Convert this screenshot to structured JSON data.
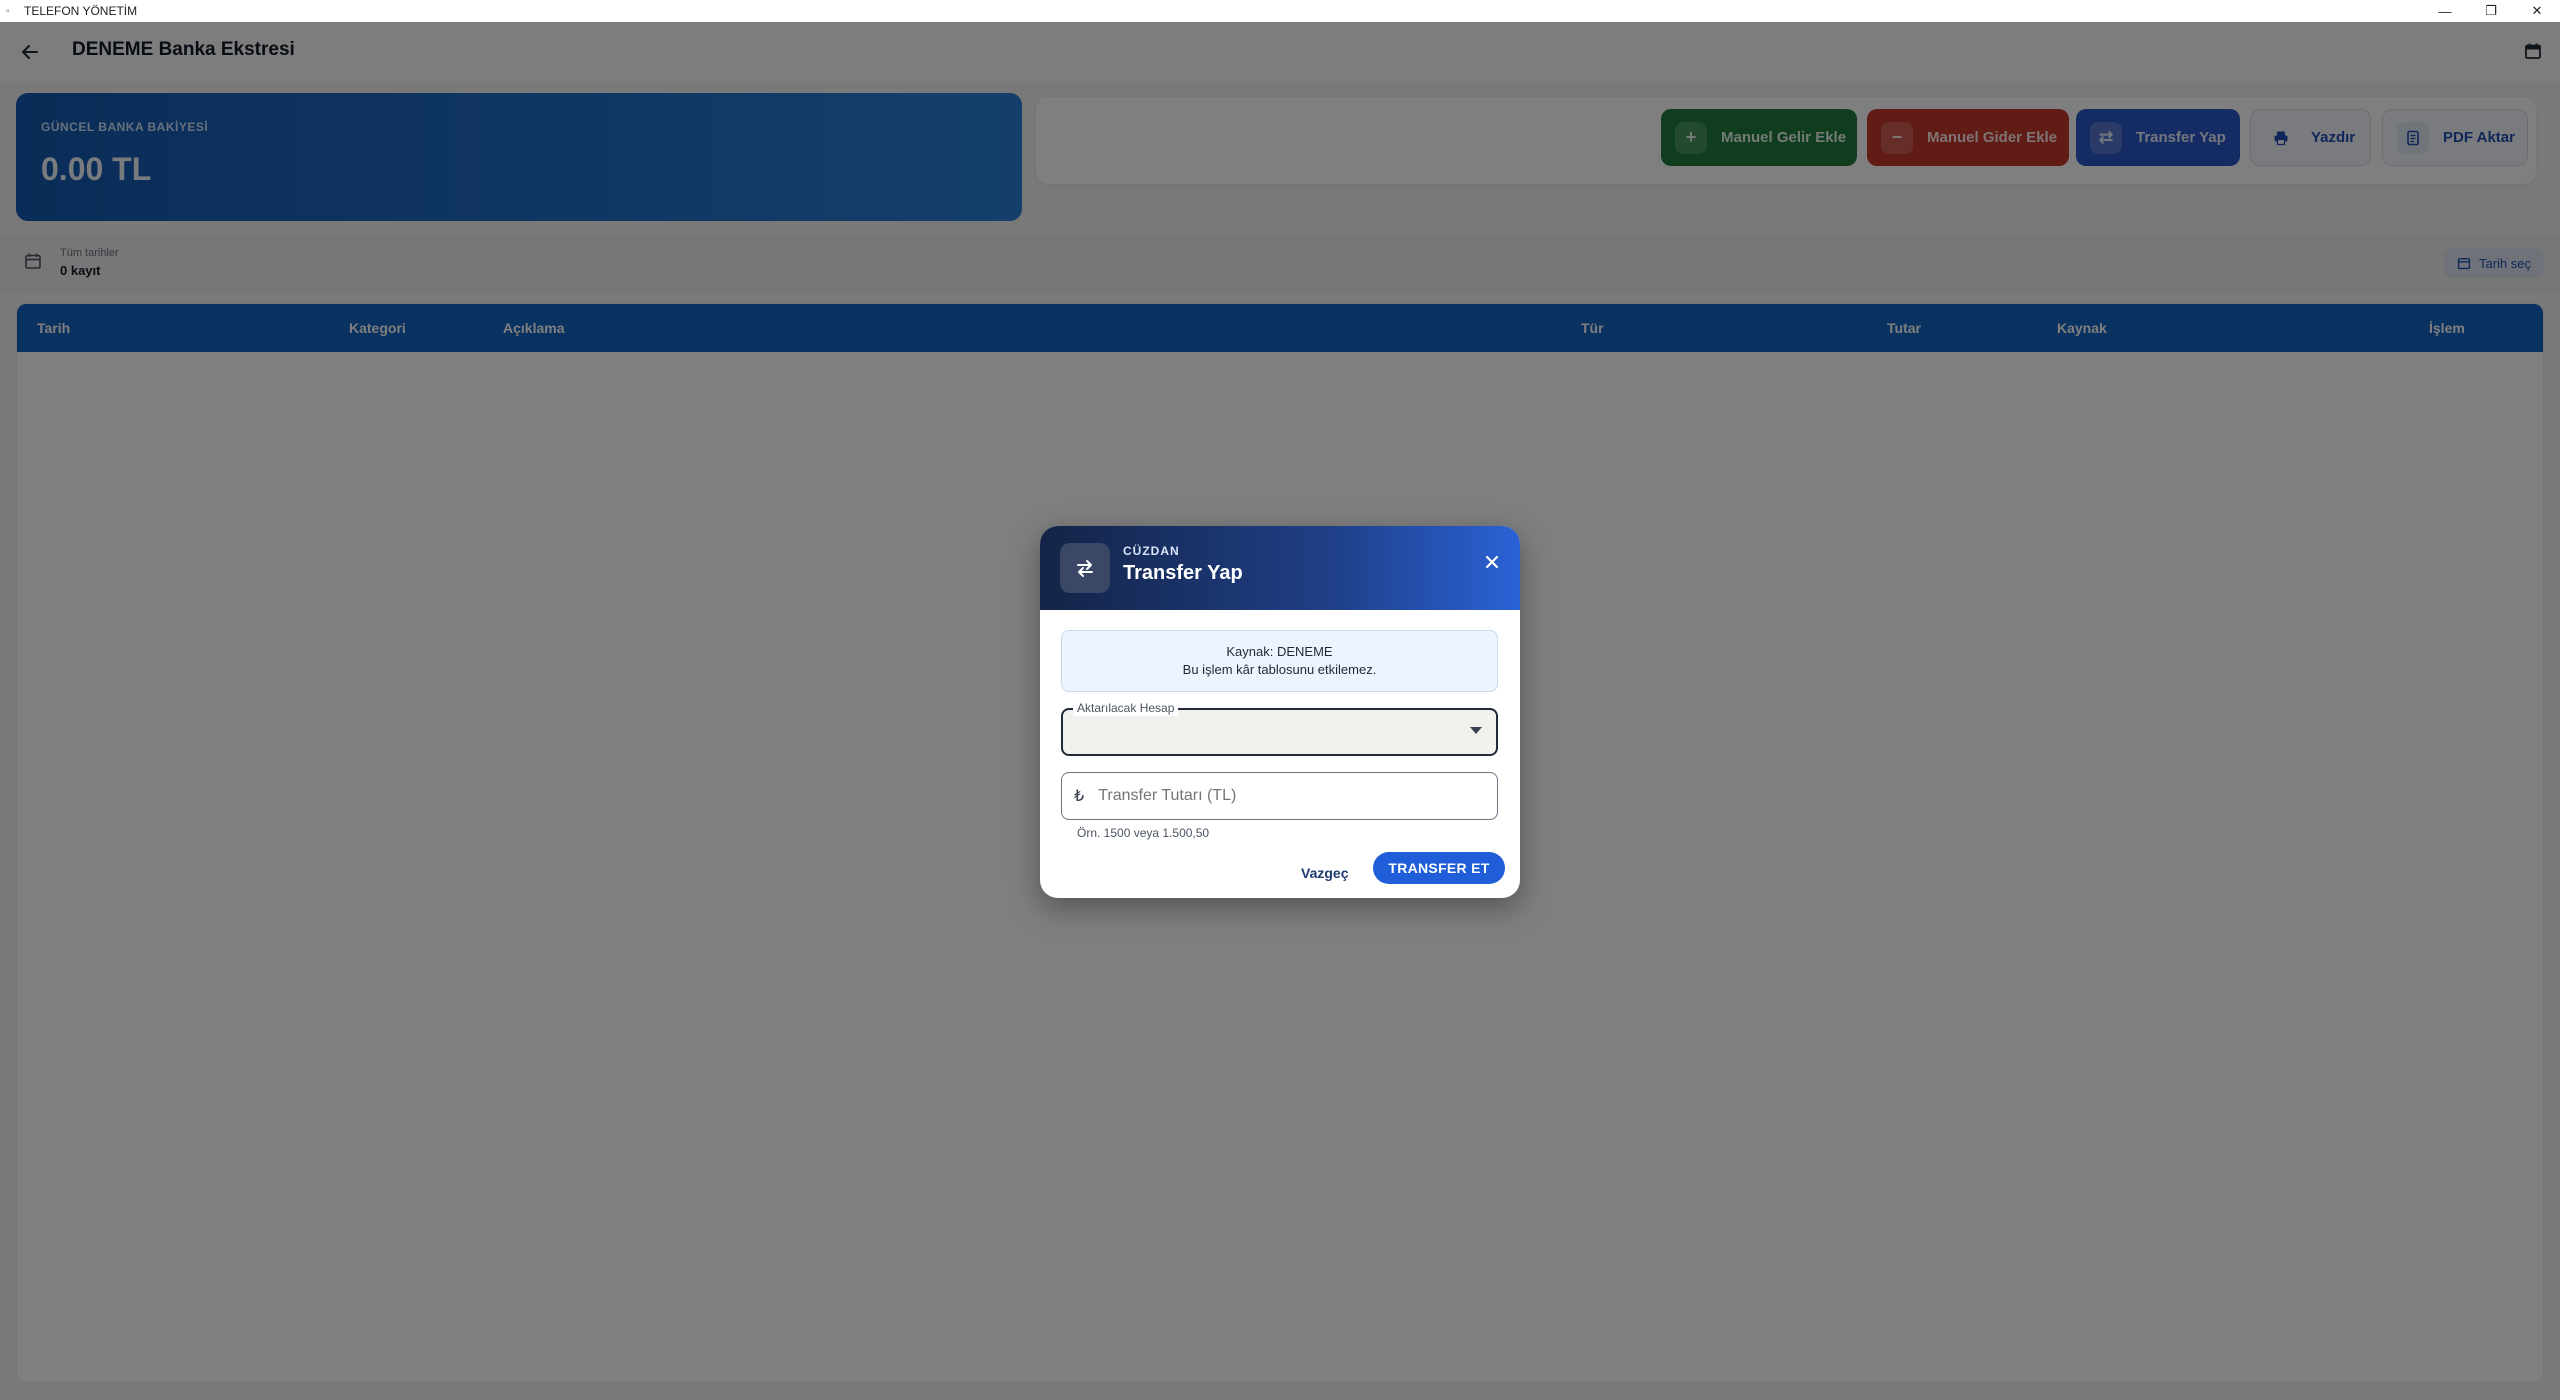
{
  "window": {
    "title": "TELEFON YÖNETİM",
    "controls": {
      "minimize": "—",
      "restore": "❐",
      "close": "✕"
    }
  },
  "appbar": {
    "title": "DENEME Banka Ekstresi",
    "back_icon": "arrow-left-icon",
    "calendar_icon": "calendar-icon"
  },
  "balance": {
    "label": "GÜNCEL BANKA BAKİYESİ",
    "value": "0.00 TL"
  },
  "actions": {
    "income": "Manuel Gelir Ekle",
    "expense": "Manuel Gider Ekle",
    "transfer": "Transfer Yap",
    "print": "Yazdır",
    "pdf": "PDF Aktar"
  },
  "filter": {
    "range_label": "Tüm tarihler",
    "count": "0 kayıt",
    "date_button": "Tarih seç"
  },
  "table": {
    "columns": [
      "Tarih",
      "Kategori",
      "Açıklama",
      "Tür",
      "Tutar",
      "Kaynak",
      "İşlem"
    ],
    "rows": []
  },
  "dialog": {
    "eyebrow": "CÜZDAN",
    "title": "Transfer Yap",
    "info_line1": "Kaynak: DENEME",
    "info_line2": "Bu işlem kâr tablosunu etkilemez.",
    "select_label": "Aktarılacak Hesap",
    "select_value": "",
    "amount_prefix": "₺",
    "amount_placeholder": "Transfer Tutarı (TL)",
    "amount_helper": "Örn. 1500 veya 1.500,50",
    "cancel": "Vazgeç",
    "submit": "TRANSFER ET"
  },
  "colors": {
    "primary": "#1565c0",
    "income": "#1e7a3c",
    "expense": "#c0392b",
    "transfer": "#2b56c6",
    "dialog_header": "#142447"
  }
}
